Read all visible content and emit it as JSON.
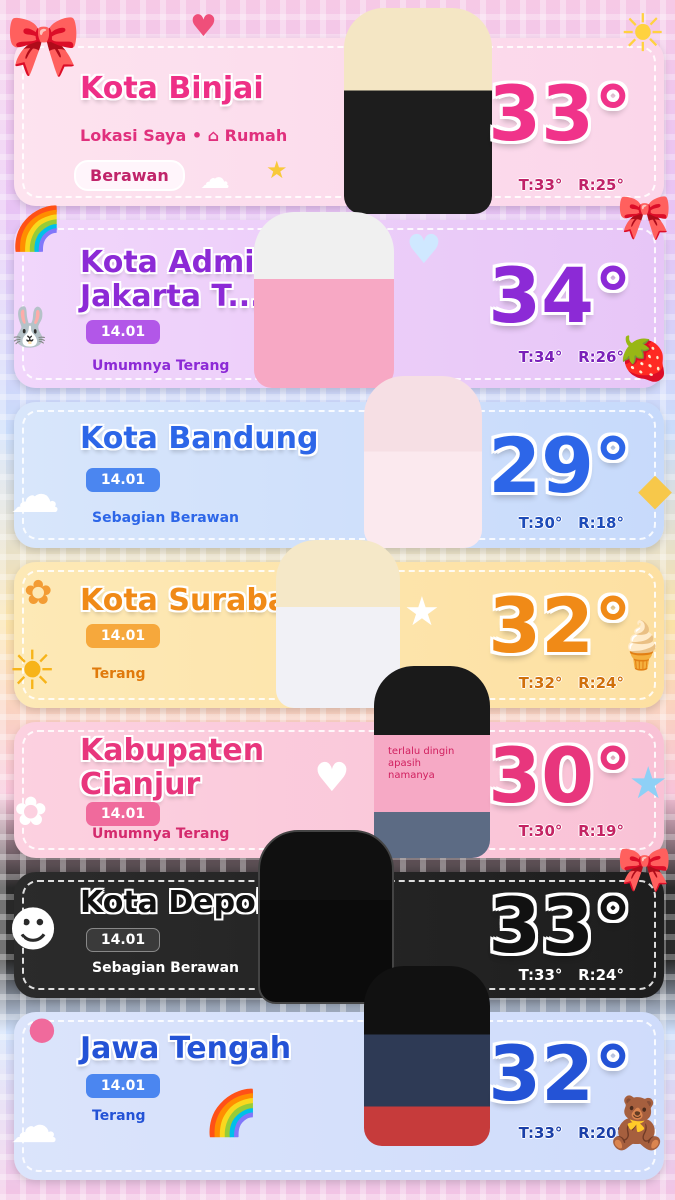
{
  "cards": [
    {
      "name": "Kota Binjai",
      "loc": "Lokasi Saya • ⌂ Rumah",
      "cond": "Berawan",
      "temp": "33°",
      "high": "T:33°",
      "low": "R:25°"
    },
    {
      "name": "Kota Admin\nJakarta T...",
      "date": "14.01",
      "cond": "Umumnya Terang",
      "temp": "34°",
      "high": "T:34°",
      "low": "R:26°"
    },
    {
      "name": "Kota Bandung",
      "date": "14.01",
      "cond": "Sebagian Berawan",
      "temp": "29°",
      "high": "T:30°",
      "low": "R:18°"
    },
    {
      "name": "Kota Surabaya",
      "date": "14.01",
      "cond": "Terang",
      "temp": "32°",
      "high": "T:32°",
      "low": "R:24°"
    },
    {
      "name": "Kabupaten\nCianjur",
      "date": "14.01",
      "cond": "Umumnya Terang",
      "temp": "30°",
      "high": "T:30°",
      "low": "R:19°"
    },
    {
      "name": "Kota Depok",
      "date": "14.01",
      "cond": "Sebagian Berawan",
      "temp": "33°",
      "high": "T:33°",
      "low": "R:24°"
    },
    {
      "name": "Jawa Tengah",
      "date": "14.01",
      "cond": "Terang",
      "temp": "32°",
      "high": "T:33°",
      "low": "R:20°"
    }
  ],
  "shirt_text": "terlalu dingin\napasih\nnamanya",
  "colors": {
    "pink": "#f0338a",
    "purple": "#8c2ad6",
    "blue": "#2d66e8",
    "orange": "#f08a17",
    "rose": "#e8367d",
    "black": "#111111",
    "navy": "#2453d6"
  }
}
